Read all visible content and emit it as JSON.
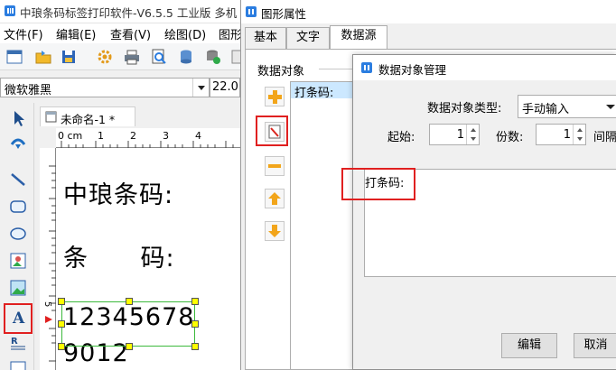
{
  "main_window": {
    "title": "中琅条码标签打印软件-V6.5.5 工业版 多机",
    "menu": [
      "文件(F)",
      "编辑(E)",
      "查看(V)",
      "绘图(D)",
      "图形"
    ],
    "font_name": "微软雅黑",
    "font_size": "22.0",
    "doc_tab": "未命名-1 *",
    "ruler_h_labels": [
      "0 cm",
      "1",
      "2",
      "3",
      "4"
    ],
    "ruler_v_labels": [
      "5"
    ],
    "canvas_lines": [
      "中琅条码:",
      "条      码:",
      "12345678",
      "9012"
    ]
  },
  "prop_dialog": {
    "title": "图形属性",
    "tabs": [
      "基本",
      "文字",
      "数据源"
    ],
    "data_object_label": "数据对象",
    "list_items": [
      "打条码:"
    ]
  },
  "dom_dialog": {
    "title": "数据对象管理",
    "type_label": "数据对象类型:",
    "type_value": "手动输入",
    "start_label": "起始:",
    "start_value": "1",
    "copies_label": "份数:",
    "copies_value": "1",
    "interval_label": "间隔",
    "content_text": "打条码:",
    "edit_button": "编辑",
    "cancel_button": "取消"
  },
  "colors": {
    "highlight": "#e02020",
    "selection": "#3cb93c",
    "handle": "#ffff00",
    "list_selected": "#cce8ff"
  }
}
